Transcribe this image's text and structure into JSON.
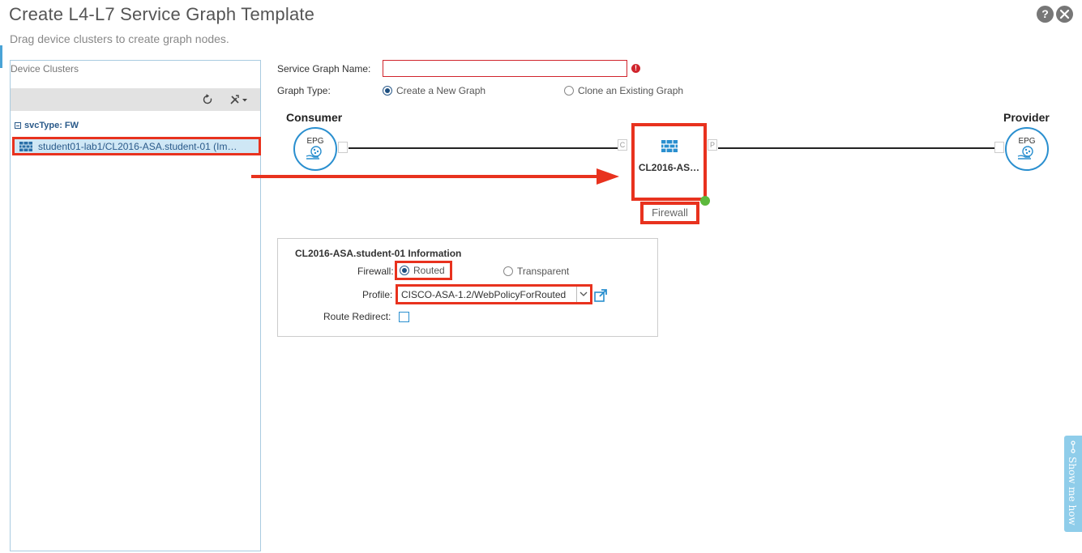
{
  "dialog": {
    "title": "Create L4-L7 Service Graph Template",
    "subtitle": "Drag device clusters to create graph nodes.",
    "help_glyph": "?"
  },
  "device_clusters": {
    "title": "Device Clusters",
    "group_label": "svcType: FW",
    "items": [
      {
        "label": "student01-lab1/CL2016-ASA.student-01 (Im…",
        "icon": "firewall-icon",
        "selected": true
      }
    ]
  },
  "form": {
    "service_graph_name_label": "Service Graph Name:",
    "service_graph_name_value": "",
    "error_glyph": "!",
    "graph_type_label": "Graph Type:",
    "graph_type_options": [
      {
        "label": "Create a New Graph",
        "selected": true
      },
      {
        "label": "Clone an Existing Graph",
        "selected": false
      }
    ]
  },
  "graph": {
    "consumer_label": "Consumer",
    "provider_label": "Provider",
    "epg_text": "EPG",
    "connector_c": "C",
    "connector_p": "P",
    "node_name": "CL2016-AS…",
    "node_function": "Firewall",
    "node_status_color": "#5cb93c"
  },
  "info_panel": {
    "title": "CL2016-ASA.student-01 Information",
    "firewall_label": "Firewall:",
    "firewall_options": [
      {
        "label": "Routed",
        "selected": true
      },
      {
        "label": "Transparent",
        "selected": false
      }
    ],
    "profile_label": "Profile:",
    "profile_value": "CISCO-ASA-1.2/WebPolicyForRouted",
    "route_redirect_label": "Route Redirect:",
    "route_redirect_checked": false
  },
  "show_me_how": {
    "label": "Show me how"
  },
  "colors": {
    "highlight": "#e8321e",
    "accent": "#2a8fcf",
    "error": "#d0242c"
  }
}
